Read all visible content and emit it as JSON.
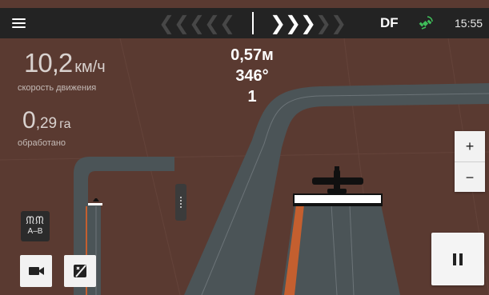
{
  "topbar": {
    "menu_icon": "hamburger-menu-icon",
    "guidance": {
      "left_chevrons": [
        "❮",
        "❮",
        "❮",
        "❮",
        "❮"
      ],
      "right_chevrons": [
        "❯",
        "❯",
        "❯",
        "❯",
        "❯"
      ],
      "active_right": 3
    },
    "mode": "DF",
    "satellite_icon": "satellite-icon",
    "time": "15:55"
  },
  "readouts": {
    "speed_value": "10,2",
    "speed_unit": "км/ч",
    "speed_label": "скорость движения",
    "area_value_int": "0",
    "area_value_frac": ",29",
    "area_unit": "га",
    "area_label": "обработано"
  },
  "center_info": {
    "offset": "0,57м",
    "heading": "346°",
    "line_number": "1"
  },
  "controls": {
    "zoom_in": "+",
    "zoom_out": "−",
    "ab_label": "A–B",
    "ab_icon": "ab-line-icon",
    "camera_icon": "video-camera-icon",
    "camera_off_icon": "camera-off-icon",
    "pause_icon": "pause-icon",
    "handle_icon": "drag-handle-icon"
  },
  "colors": {
    "field": "#5a3a31",
    "track": "#4b5457",
    "applied_strip": "#c45f2f",
    "topbar": "#232323",
    "satellite": "#3fbf5a"
  }
}
